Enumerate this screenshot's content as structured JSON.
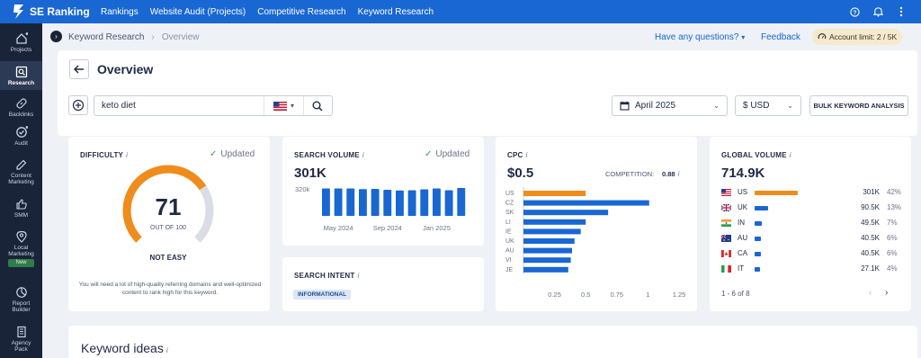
{
  "app": {
    "name": "SE Ranking"
  },
  "topnav": [
    "Rankings",
    "Website Audit (Projects)",
    "Competitive Research",
    "Keyword Research"
  ],
  "top_icons": [
    "help-icon",
    "bell-icon",
    "more-icon"
  ],
  "sidebar": [
    {
      "label": "Projects",
      "icon": "home-icon"
    },
    {
      "label": "Research",
      "icon": "research-icon",
      "active": true
    },
    {
      "label": "Backlinks",
      "icon": "link-icon"
    },
    {
      "label": "Audit",
      "icon": "check-circle-icon"
    },
    {
      "label": "Content Marketing",
      "icon": "edit-icon"
    },
    {
      "label": "SMM",
      "icon": "thumbs-up-icon"
    },
    {
      "label": "Local Marketing",
      "icon": "location-icon",
      "badge": "New"
    },
    {
      "label": "Report Builder",
      "icon": "report-icon"
    },
    {
      "label": "Agency Pack",
      "icon": "building-icon"
    }
  ],
  "breadcrumb": {
    "parent": "Keyword Research",
    "separator": "›",
    "current": "Overview"
  },
  "header_links": {
    "help": "Have any questions?",
    "feedback": "Feedback",
    "account_limit": "Account limit: 2 / 5K"
  },
  "page": {
    "title": "Overview"
  },
  "search": {
    "value": "keto diet",
    "country": "US"
  },
  "filters": {
    "date": "April 2025",
    "currency": "$ USD",
    "bulk": "BULK KEYWORD ANALYSIS"
  },
  "difficulty": {
    "title": "DIFFICULTY",
    "info": "i",
    "updated": "Updated",
    "value": "71",
    "value_num": 71,
    "max": 100,
    "out_of": "OUT OF 100",
    "level": "NOT EASY",
    "note": "You will need a lot of high-quality referring domains and well-optimized content to rank high for this keyword.",
    "colors": {
      "fill": "#f08c1b",
      "track": "#d9dde4"
    }
  },
  "search_volume": {
    "title": "SEARCH VOLUME",
    "info": "i",
    "updated": "Updated",
    "value": "301K",
    "chart_data": {
      "type": "bar",
      "y_tick": "320k",
      "x_ticks": [
        "May 2024",
        "Sep 2024",
        "Jan 2025"
      ],
      "values": [
        305,
        305,
        305,
        298,
        300,
        290,
        282,
        285,
        295,
        305,
        285,
        310
      ],
      "ylim": [
        0,
        320
      ]
    }
  },
  "search_intent": {
    "title": "SEARCH INTENT",
    "info": "i",
    "badge": "INFORMATIONAL"
  },
  "cpc": {
    "title": "CPC",
    "info": "i",
    "value": "$0.5",
    "competition_label": "COMPETITION:",
    "competition_value": "0.88",
    "chart_data": {
      "type": "bar",
      "orientation": "horizontal",
      "categories": [
        "US",
        "CZ",
        "SK",
        "LI",
        "IE",
        "UK",
        "AU",
        "VI",
        "JE"
      ],
      "values": [
        0.5,
        1.01,
        0.68,
        0.5,
        0.46,
        0.41,
        0.39,
        0.38,
        0.36
      ],
      "highlight": "US",
      "x_ticks": [
        "0.25",
        "0.5",
        "0.75",
        "1",
        "1.25"
      ],
      "xlim": [
        0,
        1.25
      ]
    }
  },
  "global_volume": {
    "title": "GLOBAL VOLUME",
    "info": "i",
    "value": "714.9K",
    "rows": [
      {
        "code": "US",
        "value": "301K",
        "pct": "42%",
        "share": 42,
        "flag": "us"
      },
      {
        "code": "UK",
        "value": "90.5K",
        "pct": "13%",
        "share": 13,
        "flag": "uk"
      },
      {
        "code": "IN",
        "value": "49.5K",
        "pct": "7%",
        "share": 7,
        "flag": "in"
      },
      {
        "code": "AU",
        "value": "40.5K",
        "pct": "6%",
        "share": 6,
        "flag": "au"
      },
      {
        "code": "CA",
        "value": "40.5K",
        "pct": "6%",
        "share": 6,
        "flag": "ca"
      },
      {
        "code": "IT",
        "value": "27.1K",
        "pct": "4%",
        "share": 4,
        "flag": "it"
      }
    ],
    "pager": "1 - 6 of 8"
  },
  "keyword_ideas": {
    "title": "Keyword ideas",
    "info": "i"
  }
}
